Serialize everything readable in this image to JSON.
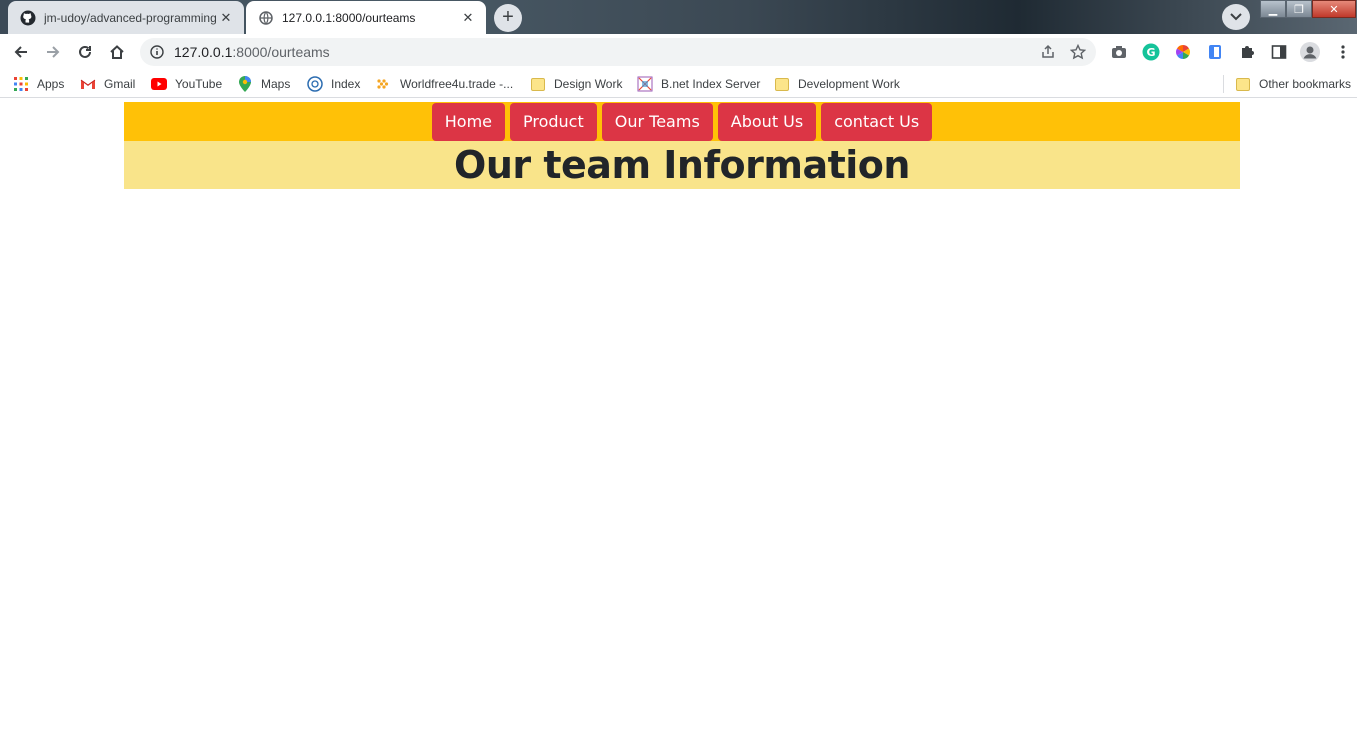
{
  "browser": {
    "tabs": [
      {
        "title": "jm-udoy/advanced-programming",
        "icon": "github-icon",
        "active": false
      },
      {
        "title": "127.0.0.1:8000/ourteams",
        "icon": "globe-icon",
        "active": true
      }
    ],
    "address": {
      "host": "127.0.0.1",
      "path": ":8000/ourteams"
    },
    "bookmarks": [
      {
        "label": "Apps",
        "icon": "apps-grid-icon"
      },
      {
        "label": "Gmail",
        "icon": "gmail-icon"
      },
      {
        "label": "YouTube",
        "icon": "youtube-icon"
      },
      {
        "label": "Maps",
        "icon": "maps-pin-icon"
      },
      {
        "label": "Index",
        "icon": "index-globe-icon"
      },
      {
        "label": "Worldfree4u.trade -...",
        "icon": "worldfree-icon"
      },
      {
        "label": "Design Work",
        "icon": "folder-icon"
      },
      {
        "label": "B.net Index Server",
        "icon": "bnet-icon"
      },
      {
        "label": "Development Work",
        "icon": "folder-icon"
      }
    ],
    "other_bookmarks": "Other bookmarks"
  },
  "site": {
    "nav": [
      {
        "label": "Home"
      },
      {
        "label": "Product"
      },
      {
        "label": "Our Teams"
      },
      {
        "label": "About Us"
      },
      {
        "label": "contact Us"
      }
    ],
    "heading": "Our team Information"
  },
  "colors": {
    "navbar_bg": "#ffc107",
    "nav_button_bg": "#dc3545",
    "banner_bg": "#f9e48a",
    "heading_text": "#212529"
  }
}
